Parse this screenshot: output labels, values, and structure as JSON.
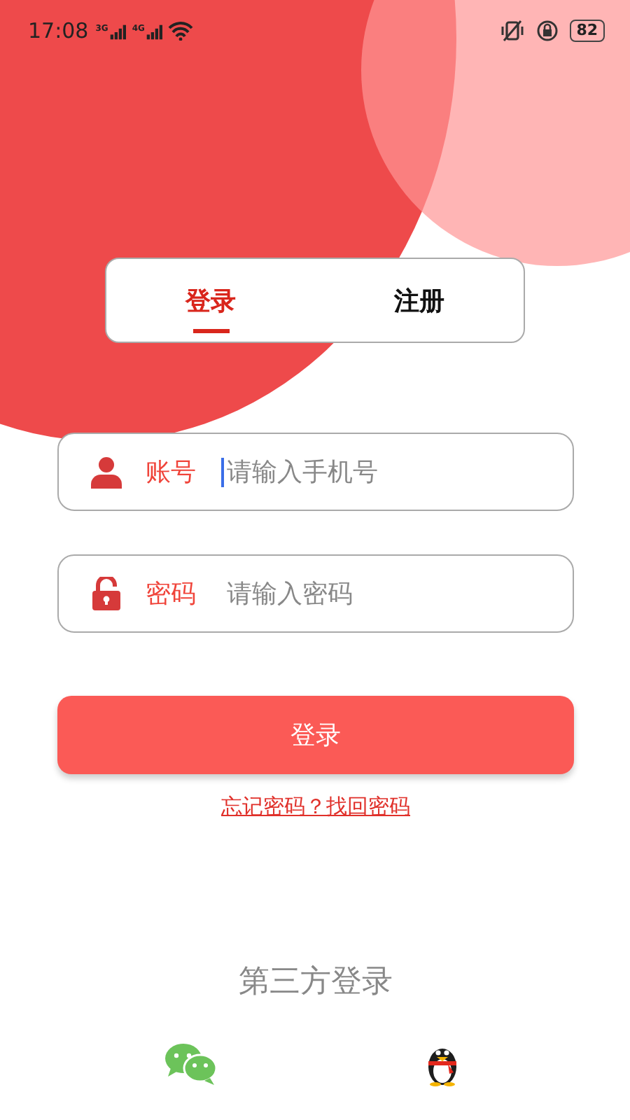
{
  "status_bar": {
    "time": "17:08",
    "battery": "82",
    "networks": [
      "3G",
      "4G"
    ]
  },
  "tabs": [
    {
      "label": "登录",
      "selected": true
    },
    {
      "label": "注册",
      "selected": false
    }
  ],
  "fields": [
    {
      "kind": "account",
      "label": "账号",
      "placeholder": "请输入手机号",
      "focused": true
    },
    {
      "kind": "password",
      "label": "密码",
      "placeholder": "请输入密码",
      "focused": false
    }
  ],
  "login_button": "登录",
  "forgot_link": "忘记密码？找回密码",
  "third_party": {
    "title": "第三方登录",
    "providers": [
      {
        "kind": "wechat"
      },
      {
        "kind": "qq"
      }
    ]
  }
}
